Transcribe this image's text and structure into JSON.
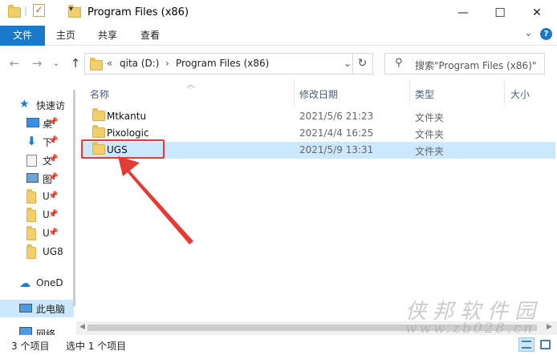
{
  "window": {
    "title": "Program Files (x86)",
    "minimize_glyph": "—",
    "maximize_glyph": "☐",
    "close_glyph": "✕"
  },
  "ribbon": {
    "tabs": [
      "文件",
      "主页",
      "共享",
      "查看"
    ],
    "collapse_glyph": "⌄",
    "help_glyph": "?"
  },
  "address_bar": {
    "back": "←",
    "forward": "→",
    "history": "⌄",
    "up": "↑",
    "overflow": "«",
    "crumbs": [
      "qita (D:)",
      "Program Files (x86)"
    ],
    "separator": "›",
    "refresh": "↻",
    "dropdown": "⌄"
  },
  "search": {
    "placeholder": "搜索\"Program Files (x86)\""
  },
  "navigation_pane": {
    "quick_access": "快速访",
    "items": [
      "桌",
      "下",
      "文",
      "图",
      "U",
      "U",
      "U",
      "UG8"
    ],
    "onedrive": "OneD",
    "this_pc": "此电脑",
    "network": "网络"
  },
  "file_list": {
    "columns": [
      "名称",
      "修改日期",
      "类型",
      "大小"
    ],
    "rows": [
      {
        "name": "Mtkantu",
        "date": "2021/5/6 21:23",
        "type": "文件夹"
      },
      {
        "name": "Pixologic",
        "date": "2021/4/4 16:25",
        "type": "文件夹"
      },
      {
        "name": "UGS",
        "date": "2021/5/9 13:31",
        "type": "文件夹"
      }
    ]
  },
  "status_bar": {
    "item_count": "3 个项目",
    "selection": "选中 1 个项目"
  },
  "watermark": {
    "line1": "侠邦软件园",
    "line2": "www.zb028.cn"
  },
  "colors": {
    "file_tab": "#1979ca",
    "selection": "#cce8ff",
    "annotation": "#e53b35"
  }
}
